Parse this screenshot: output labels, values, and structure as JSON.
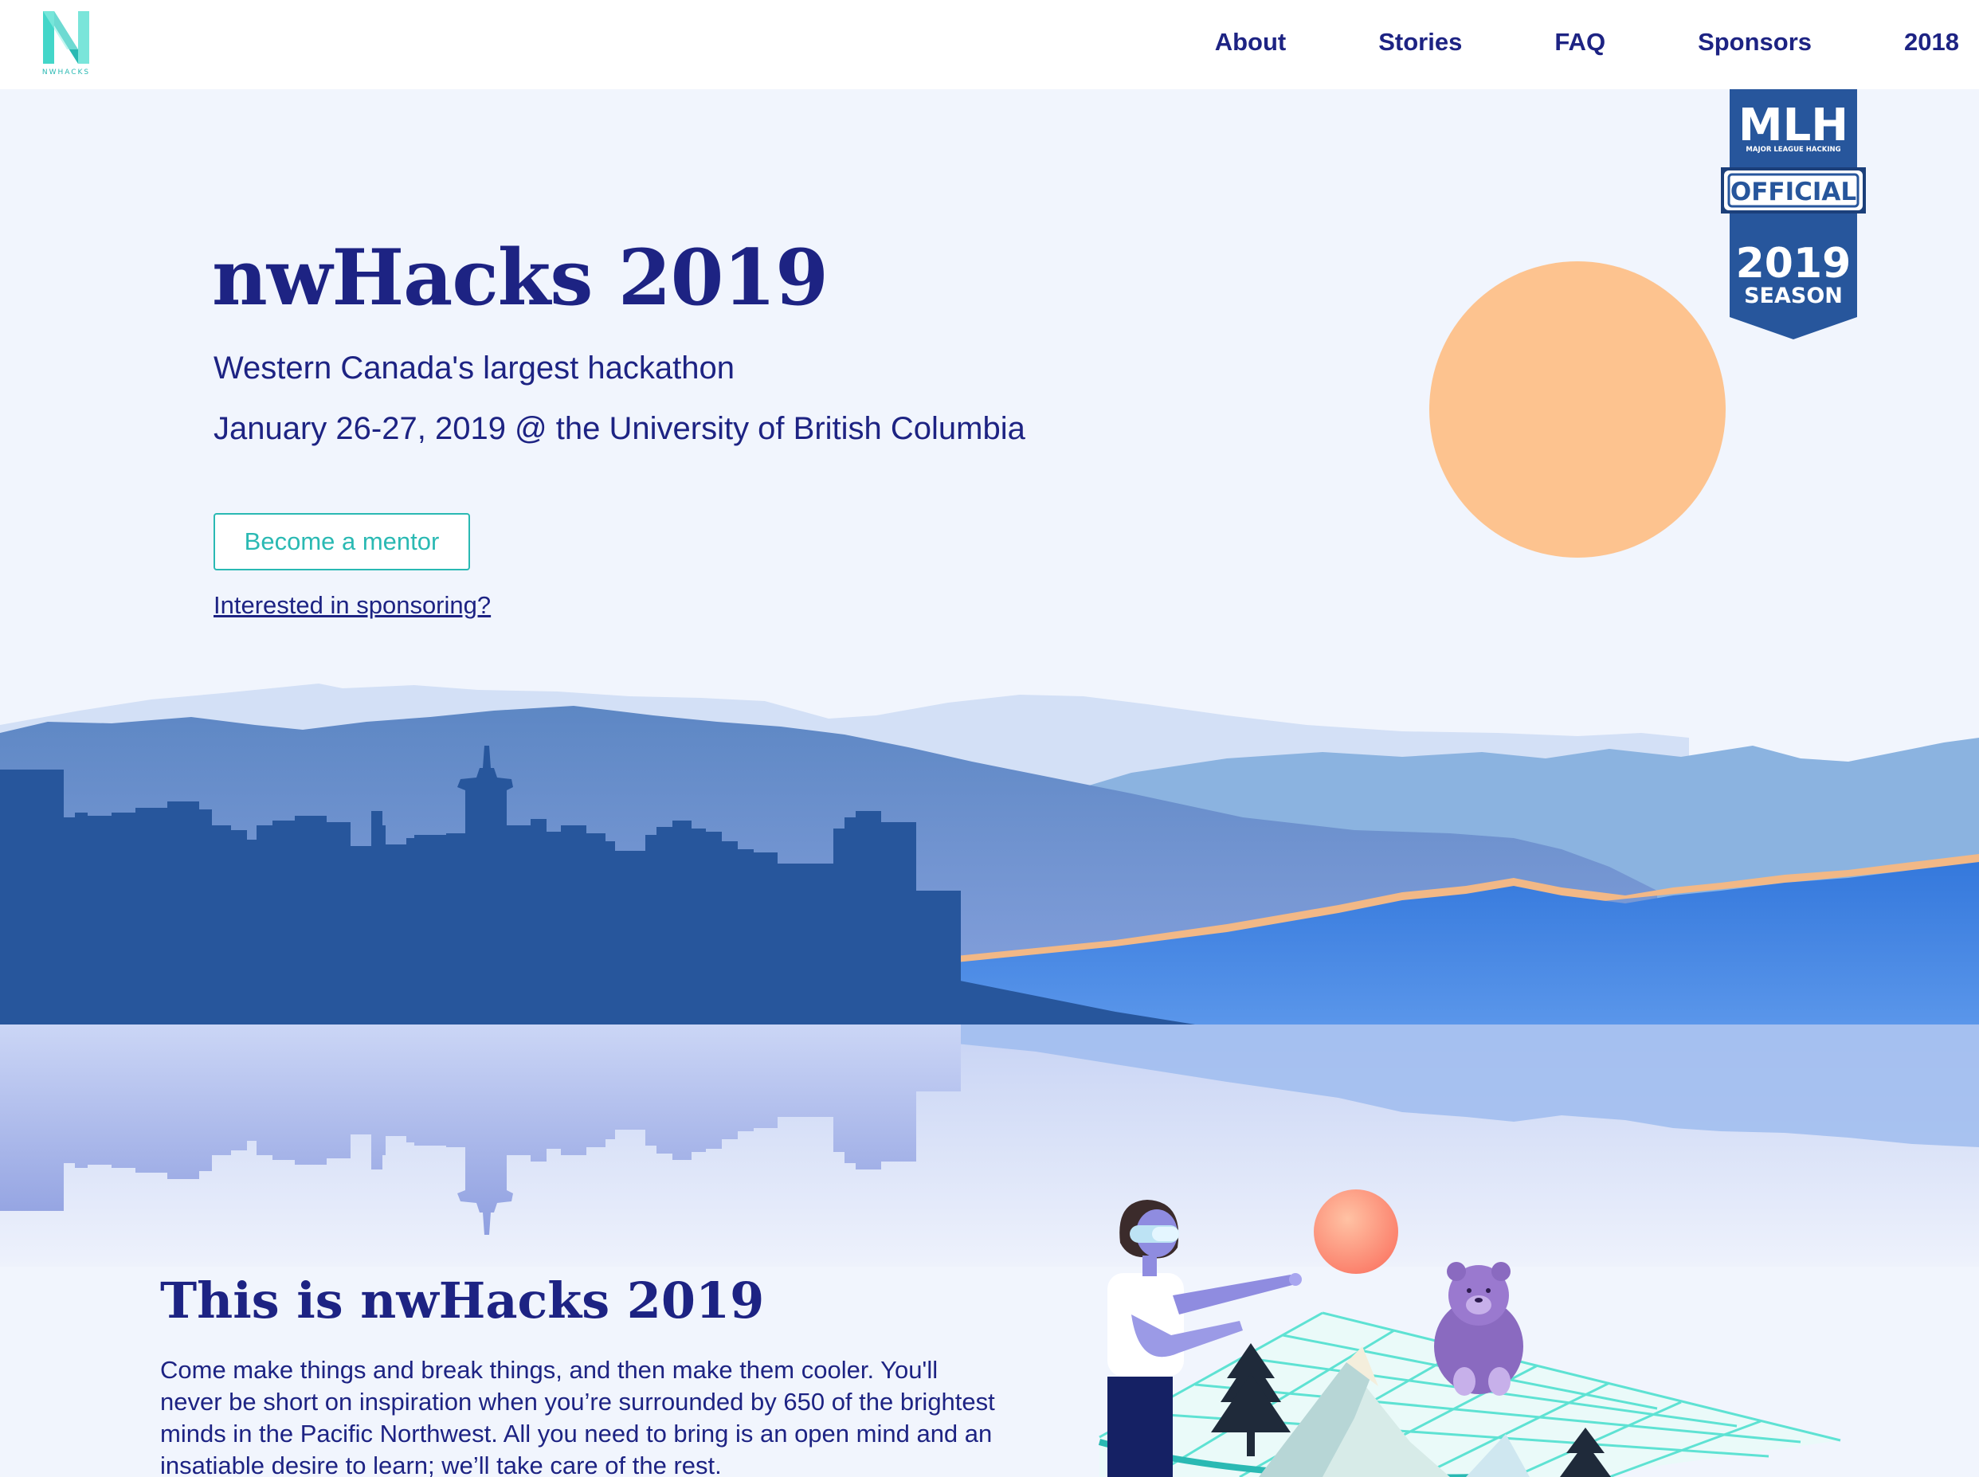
{
  "nav": {
    "logo_text": "NWHACKS",
    "links": [
      "About",
      "Stories",
      "FAQ",
      "Sponsors",
      "2018"
    ]
  },
  "hero": {
    "title": "nwHacks 2019",
    "subtitle": "Western Canada's largest hackathon",
    "date_location": "January 26-27, 2019 @ the University of British Columbia",
    "mentor_button": "Become a mentor",
    "sponsor_link": "Interested in sponsoring?"
  },
  "badge": {
    "org": "MLH",
    "org_full": "MAJOR LEAGUE HACKING",
    "ribbon": "OFFICIAL",
    "year": "2019",
    "season": "SEASON"
  },
  "about": {
    "title": "This is nwHacks 2019",
    "body": "Come make things and break things, and then make them cooler. You'll never be short on inspiration when you’re surrounded by 650 of the brightest minds in the Pacific Northwest. All you need to bring is an open mind and an insatiable desire to learn; we’ll take care of the rest."
  },
  "colors": {
    "navy": "#1d2383",
    "teal": "#2ab9b3",
    "sun": "#fdc38f",
    "skyline": "#27569c",
    "background": "#f1f5fd"
  }
}
